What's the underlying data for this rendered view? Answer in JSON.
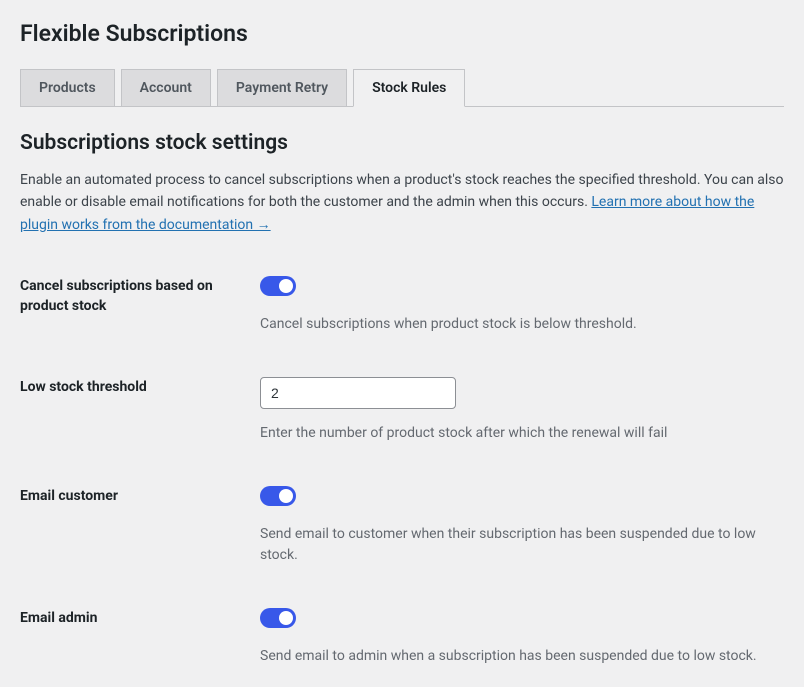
{
  "header": {
    "title": "Flexible Subscriptions"
  },
  "tabs": [
    {
      "label": "Products",
      "active": false
    },
    {
      "label": "Account",
      "active": false
    },
    {
      "label": "Payment Retry",
      "active": false
    },
    {
      "label": "Stock Rules",
      "active": true
    }
  ],
  "section": {
    "title": "Subscriptions stock settings",
    "description_before": "Enable an automated process to cancel subscriptions when a product's stock reaches the specified threshold. You can also enable or disable email notifications for both the customer and the admin when this occurs. ",
    "doc_link_text": "Learn more about how the plugin works from the documentation →"
  },
  "settings": {
    "cancel_on_stock": {
      "label": "Cancel subscriptions based on product stock",
      "help": "Cancel subscriptions when product stock is below threshold.",
      "enabled": true
    },
    "threshold": {
      "label": "Low stock threshold",
      "value": "2",
      "help": "Enter the number of product stock after which the renewal will fail"
    },
    "email_customer": {
      "label": "Email customer",
      "help": "Send email to customer when their subscription has been suspended due to low stock.",
      "enabled": true
    },
    "email_admin": {
      "label": "Email admin",
      "help": "Send email to admin when a subscription has been suspended due to low stock.",
      "enabled": true
    }
  }
}
